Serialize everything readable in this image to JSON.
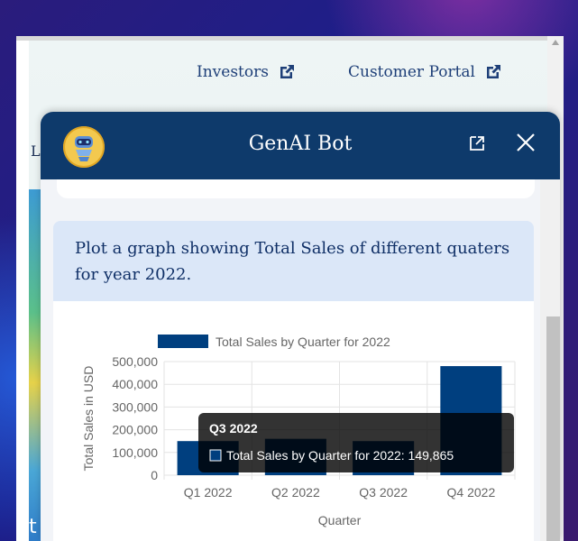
{
  "site": {
    "nav_links": [
      {
        "label": "Investors"
      },
      {
        "label": "Customer Portal"
      }
    ],
    "partial_left_letter": "L",
    "partial_bottom_letter": "t"
  },
  "chat": {
    "title": "GenAI Bot",
    "user_message": "Plot a graph showing Total Sales of different quaters for year 2022.",
    "header_icons": [
      "bot-avatar",
      "popout-icon",
      "close-icon"
    ]
  },
  "colors": {
    "header": "#0e3a6b",
    "bar": "#003f7f",
    "user_bubble": "#dbe7f8"
  },
  "chart_data": {
    "type": "bar",
    "categories": [
      "Q1 2022",
      "Q2 2022",
      "Q3 2022",
      "Q4 2022"
    ],
    "series": [
      {
        "name": "Total Sales by Quarter for 2022",
        "values": [
          150000,
          160000,
          149865,
          480000
        ]
      }
    ],
    "xlabel": "Quarter",
    "ylabel": "Total Sales in USD",
    "ylim": [
      0,
      500000
    ],
    "yticks": [
      "0",
      "100,000",
      "200,000",
      "300,000",
      "400,000",
      "500,000"
    ],
    "legend": "top",
    "grid": true,
    "tooltip": {
      "title": "Q3 2022",
      "line": "Total Sales by Quarter for 2022: 149,865"
    }
  }
}
